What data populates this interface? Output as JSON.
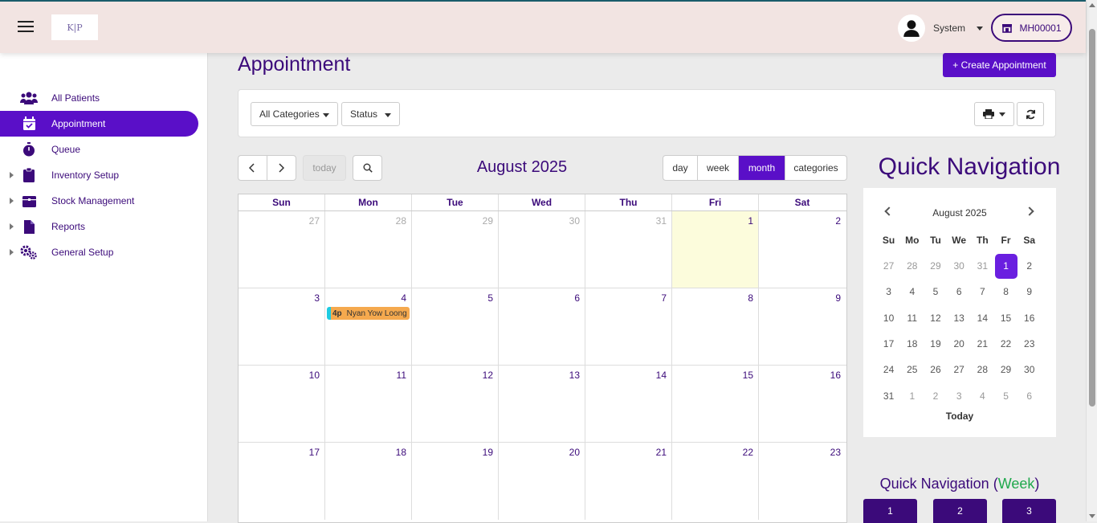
{
  "header": {
    "logo_text": "K|P",
    "user_name": "System",
    "branch_code": "MH00001"
  },
  "sidebar": {
    "items": [
      {
        "label": "All Patients",
        "icon": "users-icon"
      },
      {
        "label": "Appointment",
        "icon": "calendar-check-icon"
      },
      {
        "label": "Queue",
        "icon": "stopwatch-icon"
      },
      {
        "label": "Inventory Setup",
        "icon": "clipboard-icon"
      },
      {
        "label": "Stock Management",
        "icon": "box-icon"
      },
      {
        "label": "Reports",
        "icon": "file-icon"
      },
      {
        "label": "General Setup",
        "icon": "gears-icon"
      }
    ]
  },
  "page": {
    "title": "Appointment",
    "create_label": "+ Create Appointment"
  },
  "filters": {
    "categories": "All Categories",
    "status": "Status"
  },
  "calendar": {
    "title": "August 2025",
    "today_label": "today",
    "views": [
      "day",
      "week",
      "month",
      "categories"
    ],
    "active_view": "month",
    "days_of_week": [
      "Sun",
      "Mon",
      "Tue",
      "Wed",
      "Thu",
      "Fri",
      "Sat"
    ],
    "weeks": [
      [
        "27",
        "28",
        "29",
        "30",
        "31",
        "1",
        "2"
      ],
      [
        "3",
        "4",
        "5",
        "6",
        "7",
        "8",
        "9"
      ],
      [
        "10",
        "11",
        "12",
        "13",
        "14",
        "15",
        "16"
      ],
      [
        "17",
        "18",
        "19",
        "20",
        "21",
        "22",
        "23"
      ]
    ],
    "event": {
      "time": "4p",
      "name": "Nyan Yow Loong"
    }
  },
  "quick_nav": {
    "title": "Quick Navigation",
    "month_label": "August 2025",
    "dow": [
      "Su",
      "Mo",
      "Tu",
      "We",
      "Th",
      "Fr",
      "Sa"
    ],
    "weeks": [
      [
        "27",
        "28",
        "29",
        "30",
        "31",
        "1",
        "2"
      ],
      [
        "3",
        "4",
        "5",
        "6",
        "7",
        "8",
        "9"
      ],
      [
        "10",
        "11",
        "12",
        "13",
        "14",
        "15",
        "16"
      ],
      [
        "17",
        "18",
        "19",
        "20",
        "21",
        "22",
        "23"
      ],
      [
        "24",
        "25",
        "26",
        "27",
        "28",
        "29",
        "30"
      ],
      [
        "31",
        "1",
        "2",
        "3",
        "4",
        "5",
        "6"
      ]
    ],
    "today_label": "Today",
    "week_title_prefix": "Quick Navigation (",
    "week_word": "Week",
    "week_title_suffix": ")",
    "week_buttons": [
      "1",
      "2",
      "3"
    ]
  },
  "colors": {
    "primary": "#5a0fc8",
    "dark_purple": "#3b0a7a",
    "today_bg": "#fcfcdc",
    "event_bg": "#f5a94e",
    "event_border": "#1ecbe1",
    "week_green": "#1fa84c"
  }
}
